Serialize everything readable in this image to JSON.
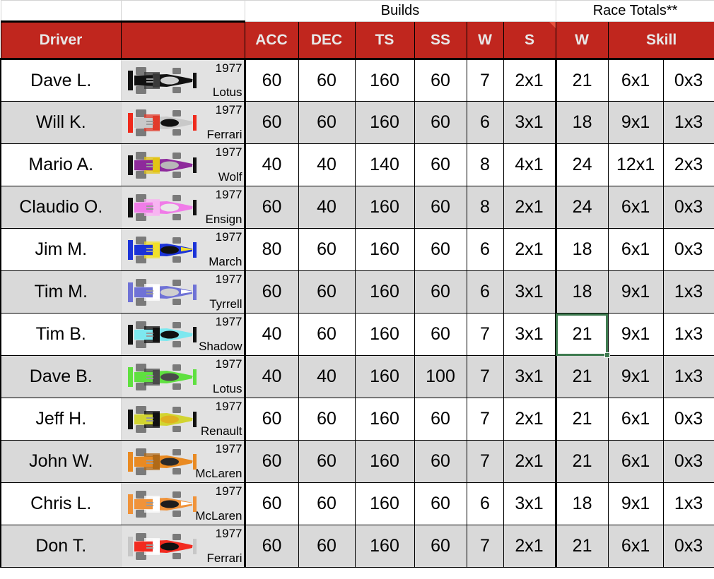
{
  "colors": {
    "header_red": "#c0261e",
    "header_text": "#e8e8e8",
    "alt_row": "#d9d9d9",
    "selection_green": "#3d7a4f",
    "grid_line": "#000000",
    "car_cell_bg": "#e2e2e2"
  },
  "group_headers": {
    "blank_a": "",
    "blank_b": "",
    "builds": "Builds",
    "race_totals": "Race Totals**"
  },
  "columns": {
    "driver": "Driver",
    "car": "",
    "acc": "ACC",
    "dec": "DEC",
    "ts": "TS",
    "ss": "SS",
    "w_build": "W",
    "s_build": "S",
    "w_total": "W",
    "skill": "Skill",
    "skill_b": ""
  },
  "selection": {
    "row_index": 6,
    "column": "w_total",
    "value": "21"
  },
  "rows": [
    {
      "driver": "Dave L.",
      "year": "1977",
      "team": "Lotus",
      "car": {
        "body": "#111111",
        "accent": "#3a3a3a",
        "nose": "#111111",
        "wing": "#111111",
        "cockpit": "#cfcfcf"
      },
      "acc": "60",
      "dec": "60",
      "ts": "160",
      "ss": "60",
      "w_build": "7",
      "s_build": "2x1",
      "w_total": "21",
      "skill": "6x1",
      "skill_b": "0x3"
    },
    {
      "driver": "Will K.",
      "year": "1977",
      "team": "Ferrari",
      "car": {
        "body": "#c9c9c9",
        "accent": "#e23b2b",
        "nose": "#c9c9c9",
        "wing": "#ef2a1c",
        "cockpit": "#101010"
      },
      "acc": "60",
      "dec": "60",
      "ts": "160",
      "ss": "60",
      "w_build": "6",
      "s_build": "3x1",
      "w_total": "18",
      "skill": "9x1",
      "skill_b": "1x3"
    },
    {
      "driver": "Mario A.",
      "year": "1977",
      "team": "Wolf",
      "car": {
        "body": "#8e2a9b",
        "accent": "#e3c414",
        "nose": "#8e2a9b",
        "wing": "#121212",
        "cockpit": "#b8b8b8"
      },
      "acc": "40",
      "dec": "40",
      "ts": "140",
      "ss": "60",
      "w_build": "8",
      "s_build": "4x1",
      "w_total": "24",
      "skill": "12x1",
      "skill_b": "2x3"
    },
    {
      "driver": "Claudio O.",
      "year": "1977",
      "team": "Ensign",
      "car": {
        "body": "#f07ce8",
        "accent": "#f8b4f2",
        "nose": "#f07ce8",
        "wing": "#111111",
        "cockpit": "#e8e8e8"
      },
      "acc": "60",
      "dec": "40",
      "ts": "160",
      "ss": "60",
      "w_build": "8",
      "s_build": "2x1",
      "w_total": "24",
      "skill": "6x1",
      "skill_b": "0x3"
    },
    {
      "driver": "Jim M.",
      "year": "1977",
      "team": "March",
      "car": {
        "body": "#1b33d8",
        "accent": "#f2e02a",
        "nose": "#f2e02a",
        "wing": "#1b33d8",
        "cockpit": "#101010"
      },
      "acc": "80",
      "dec": "60",
      "ts": "160",
      "ss": "60",
      "w_build": "6",
      "s_build": "2x1",
      "w_total": "18",
      "skill": "6x1",
      "skill_b": "0x3"
    },
    {
      "driver": "Tim M.",
      "year": "1977",
      "team": "Tyrrell",
      "car": {
        "body": "#6f72d6",
        "accent": "#ffffff",
        "nose": "#ffffff",
        "wing": "#6f72d6",
        "cockpit": "#cfcfcf"
      },
      "acc": "60",
      "dec": "60",
      "ts": "160",
      "ss": "60",
      "w_build": "6",
      "s_build": "3x1",
      "w_total": "18",
      "skill": "9x1",
      "skill_b": "1x3"
    },
    {
      "driver": "Tim B.",
      "year": "1977",
      "team": "Shadow",
      "car": {
        "body": "#7de8ef",
        "accent": "#111111",
        "nose": "#7de8ef",
        "wing": "#111111",
        "cockpit": "#111111"
      },
      "acc": "40",
      "dec": "60",
      "ts": "160",
      "ss": "60",
      "w_build": "7",
      "s_build": "3x1",
      "w_total": "21",
      "skill": "9x1",
      "skill_b": "1x3"
    },
    {
      "driver": "Dave B.",
      "year": "1977",
      "team": "Lotus",
      "car": {
        "body": "#5fe040",
        "accent": "#4a4a4a",
        "nose": "#5fe040",
        "wing": "#5fe040",
        "cockpit": "#4a4a4a"
      },
      "acc": "40",
      "dec": "40",
      "ts": "160",
      "ss": "100",
      "w_build": "7",
      "s_build": "3x1",
      "w_total": "21",
      "skill": "9x1",
      "skill_b": "1x3"
    },
    {
      "driver": "Jeff H.",
      "year": "1977",
      "team": "Renault",
      "car": {
        "body": "#d2d431",
        "accent": "#111111",
        "nose": "#d2d431",
        "wing": "#111111",
        "cockpit": "#e0b020"
      },
      "acc": "60",
      "dec": "60",
      "ts": "160",
      "ss": "60",
      "w_build": "7",
      "s_build": "2x1",
      "w_total": "21",
      "skill": "6x1",
      "skill_b": "0x3"
    },
    {
      "driver": "John W.",
      "year": "1977",
      "team": "McLaren",
      "car": {
        "body": "#e98a22",
        "accent": "#b06a18",
        "nose": "#e98a22",
        "wing": "#e98a22",
        "cockpit": "#2a2a2a"
      },
      "acc": "60",
      "dec": "60",
      "ts": "160",
      "ss": "60",
      "w_build": "7",
      "s_build": "2x1",
      "w_total": "21",
      "skill": "6x1",
      "skill_b": "0x3"
    },
    {
      "driver": "Chris L.",
      "year": "1977",
      "team": "McLaren",
      "car": {
        "body": "#f0933a",
        "accent": "#ffffff",
        "nose": "#ffffff",
        "wing": "#f0933a",
        "cockpit": "#1d1d1d"
      },
      "acc": "60",
      "dec": "60",
      "ts": "160",
      "ss": "60",
      "w_build": "6",
      "s_build": "3x1",
      "w_total": "18",
      "skill": "9x1",
      "skill_b": "1x3"
    },
    {
      "driver": "Don T.",
      "year": "1977",
      "team": "Ferrari",
      "car": {
        "body": "#f22b20",
        "accent": "#ffffff",
        "nose": "#f22b20",
        "wing": "#c7c7c7",
        "cockpit": "#111111"
      },
      "acc": "60",
      "dec": "60",
      "ts": "160",
      "ss": "60",
      "w_build": "7",
      "s_build": "2x1",
      "w_total": "21",
      "skill": "6x1",
      "skill_b": "0x3"
    }
  ]
}
